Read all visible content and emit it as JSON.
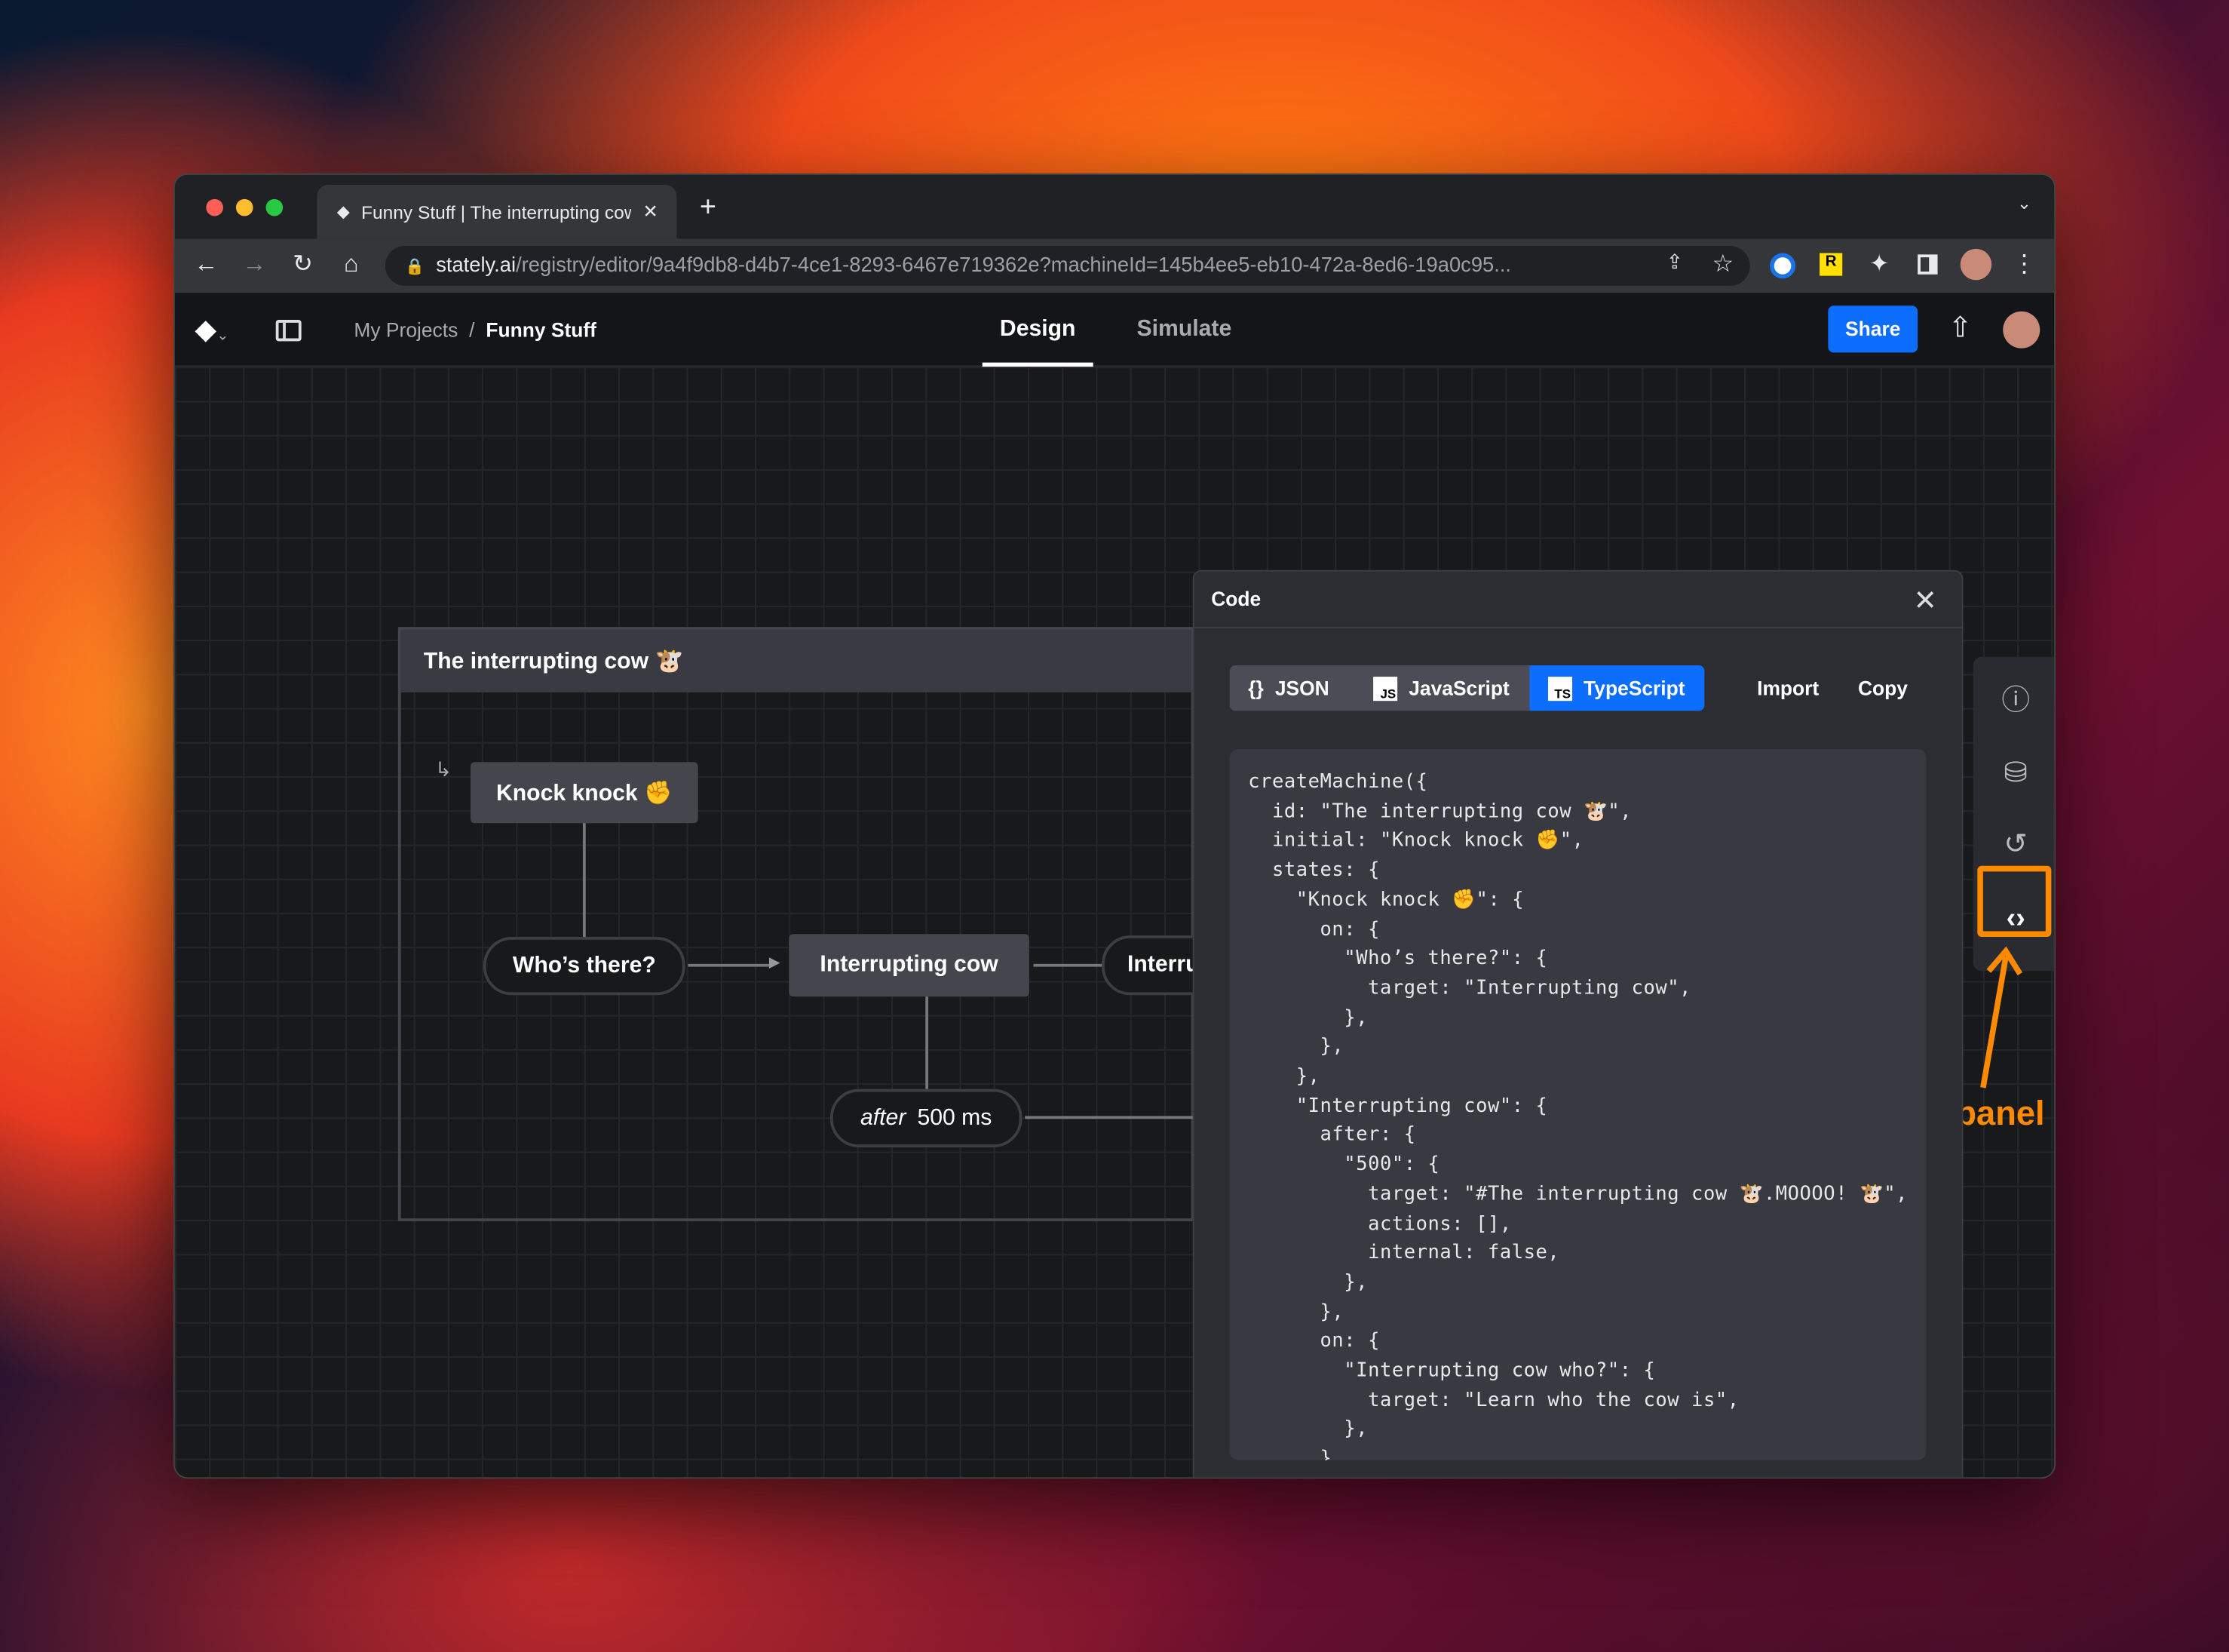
{
  "browser": {
    "tab_title": "Funny Stuff | The interrupting cow",
    "url_domain": "stately.ai",
    "url_path": "/registry/editor/9a4f9db8-d4b7-4ce1-8293-6467e719362e?machineId=145b4ee5-eb10-472a-8ed6-19a0c95..."
  },
  "app": {
    "breadcrumb": {
      "parent": "My Projects",
      "separator": "/",
      "current": "Funny Stuff"
    },
    "tabs": [
      {
        "label": "Design",
        "active": true
      },
      {
        "label": "Simulate",
        "active": false
      }
    ],
    "share_label": "Share"
  },
  "machine": {
    "title": "The interrupting cow 🐮",
    "states": {
      "knock": "Knock knock ✊",
      "interrupting": "Interrupting cow",
      "next_partial": "Interru"
    },
    "events": {
      "whos_there": "Who’s there?",
      "after_kw": "after",
      "after_val": "500 ms"
    }
  },
  "code_panel": {
    "title": "Code",
    "formats": [
      {
        "label": "JSON",
        "icon": "{}"
      },
      {
        "label": "JavaScript",
        "icon": "JS"
      },
      {
        "label": "TypeScript",
        "icon": "TS",
        "active": true
      }
    ],
    "import_label": "Import",
    "copy_label": "Copy",
    "code": "createMachine({\n  id: \"The interrupting cow 🐮\",\n  initial: \"Knock knock ✊\",\n  states: {\n    \"Knock knock ✊\": {\n      on: {\n        \"Who’s there?\": {\n          target: \"Interrupting cow\",\n        },\n      },\n    },\n    \"Interrupting cow\": {\n      after: {\n        \"500\": {\n          target: \"#The interrupting cow 🐮.MOOOO! 🐮\",\n          actions: [],\n          internal: false,\n        },\n      },\n      on: {\n        \"Interrupting cow who?\": {\n          target: \"Learn who the cow is\",\n        },\n      }"
  },
  "annotation": {
    "label": "Code panel",
    "color": "#ff8a00"
  },
  "colors": {
    "accent": "#0d6efd",
    "annotation": "#ff8a00"
  },
  "help_label": "?"
}
